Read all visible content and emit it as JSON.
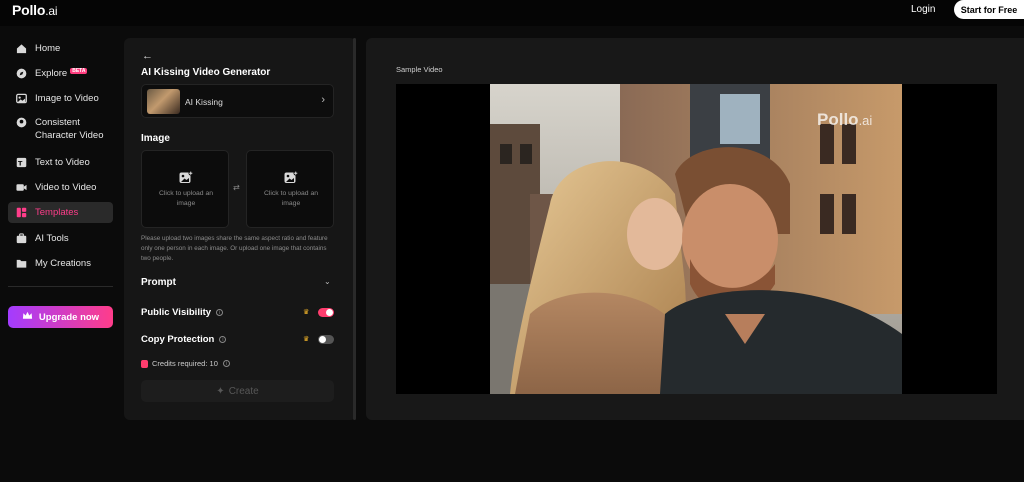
{
  "header": {
    "logo_main": "Pollo",
    "logo_suffix": ".ai",
    "login_label": "Login",
    "start_label": "Start for Free"
  },
  "sidebar": {
    "items": [
      {
        "label": "Home",
        "icon": "home-icon"
      },
      {
        "label": "Explore",
        "icon": "compass-icon",
        "badge": "BETA"
      },
      {
        "label": "Image to Video",
        "icon": "image-icon"
      },
      {
        "label": "Consistent Character Video",
        "icon": "character-icon"
      },
      {
        "label": "Text to Video",
        "icon": "text-icon"
      },
      {
        "label": "Video to Video",
        "icon": "video-icon"
      },
      {
        "label": "Templates",
        "icon": "templates-icon",
        "active": true
      },
      {
        "label": "AI Tools",
        "icon": "toolbox-icon"
      },
      {
        "label": "My Creations",
        "icon": "folder-icon"
      }
    ],
    "upgrade_label": "Upgrade now"
  },
  "panel": {
    "title": "AI Kissing Video Generator",
    "template_name": "AI Kissing",
    "image_section": "Image",
    "upload_left": "Click to upload an image",
    "upload_right": "Click to upload an image",
    "hint": "Please upload two images share the same aspect ratio and feature only one person in each image. Or upload one image that contains two people.",
    "prompt_label": "Prompt",
    "public_visibility_label": "Public Visibility",
    "public_visibility_on": true,
    "copy_protection_label": "Copy Protection",
    "copy_protection_on": false,
    "credits_label": "Credits required: 10",
    "create_label": "Create"
  },
  "main": {
    "sample_label": "Sample Video",
    "watermark_main": "Pollo",
    "watermark_suffix": ".ai"
  },
  "colors": {
    "accent": "#ff3d8a",
    "toggle_on": "#ff3d6e",
    "upgrade_from": "#a33cff",
    "upgrade_to": "#ff3d8a"
  }
}
